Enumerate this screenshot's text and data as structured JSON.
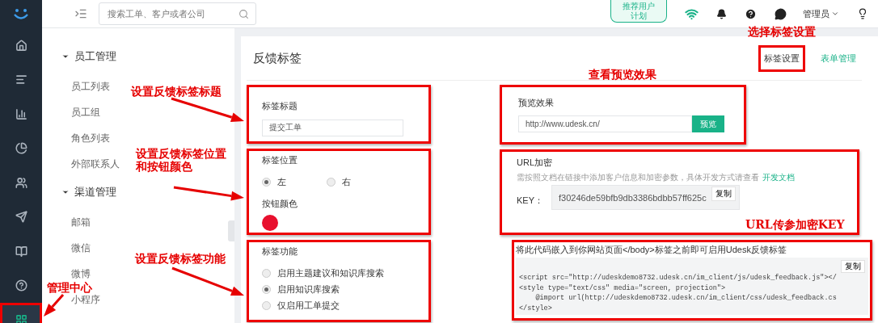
{
  "rail": {
    "items": [
      {
        "kind": "home",
        "selected": false
      },
      {
        "kind": "list",
        "selected": false
      },
      {
        "kind": "bars",
        "selected": false
      },
      {
        "kind": "pie",
        "selected": false
      },
      {
        "kind": "users",
        "selected": false
      },
      {
        "kind": "send",
        "selected": false
      },
      {
        "kind": "book",
        "selected": false
      },
      {
        "kind": "help",
        "selected": false
      },
      {
        "kind": "grid",
        "selected": true
      }
    ]
  },
  "topbar": {
    "search": {
      "placeholder": "搜索工单、客户或者公司"
    },
    "promo": [
      "推荐用户",
      "计划"
    ],
    "user": "管理员"
  },
  "sidebar": {
    "groups": [
      {
        "title": "员工管理",
        "expanded": true,
        "items": [
          "员工列表",
          "员工组",
          "角色列表",
          "外部联系人"
        ]
      },
      {
        "title": "渠道管理",
        "expanded": true,
        "items": [
          "邮箱",
          "微信",
          "微博",
          "小程序"
        ]
      }
    ]
  },
  "page": {
    "title": "反馈标签",
    "tabs": [
      {
        "label": "标签设置",
        "selected": true
      },
      {
        "label": "表单管理",
        "selected": false
      }
    ]
  },
  "form": {
    "title_label": "标签标题",
    "title_value": "提交工单",
    "position_label": "标签位置",
    "positions": [
      {
        "label": "左",
        "selected": true
      },
      {
        "label": "右",
        "selected": false
      }
    ],
    "color_label": "按钮颜色",
    "color": "#e8102e",
    "function_label": "标签功能",
    "functions": [
      {
        "label": "启用主题建议和知识库搜索",
        "selected": false
      },
      {
        "label": "启用知识库搜索",
        "selected": true
      },
      {
        "label": "仅启用工单提交",
        "selected": false
      }
    ]
  },
  "preview": {
    "label": "预览效果",
    "url": "http://www.udesk.cn/",
    "button": "预览"
  },
  "url_encryption": {
    "label": "URL加密",
    "hint": "需按照文档在链接中添加客户信息和加密参数，具体开发方式请查看",
    "link": "开发文档",
    "key_label": "KEY：",
    "key": "f30246de59bfb9db3386bdbb57ff625c",
    "copy": "复制"
  },
  "embed": {
    "instruction": "将此代码嵌入到你网站页面</body>标签之前即可启用Udesk反馈标签",
    "copy": "复制",
    "code": [
      "<script src=\"http://udeskdemo8732.udesk.cn/im_client/js/udesk_feedback.js\"></",
      "<style type=\"text/css\" media=\"screen, projection\">",
      "    @import url(http://udeskdemo8732.udesk.cn/im_client/css/udesk_feedback.cs",
      "</style>"
    ]
  },
  "annotations": [
    {
      "text": "选择标签设置"
    },
    {
      "text": "查看预览效果"
    },
    {
      "text": "设置反馈标签标题"
    },
    {
      "text": "设置反馈标签位置和按钮颜色"
    },
    {
      "text": "设置反馈标签功能"
    },
    {
      "text": "管理中心"
    },
    {
      "text": "URL传参加密KEY"
    }
  ]
}
